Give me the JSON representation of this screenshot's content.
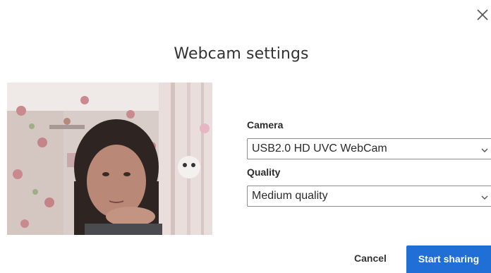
{
  "dialog": {
    "title": "Webcam settings",
    "close_icon": "close-icon"
  },
  "camera": {
    "label": "Camera",
    "selected": "USB2.0 HD UVC WebCam",
    "chevron_icon": "chevron-down-icon"
  },
  "quality": {
    "label": "Quality",
    "selected": "Medium quality",
    "chevron_icon": "chevron-down-icon"
  },
  "actions": {
    "cancel_label": "Cancel",
    "start_label": "Start sharing"
  },
  "colors": {
    "primary": "#1f6fd6",
    "text": "#2b2b2b",
    "border": "#8c8c8c"
  }
}
